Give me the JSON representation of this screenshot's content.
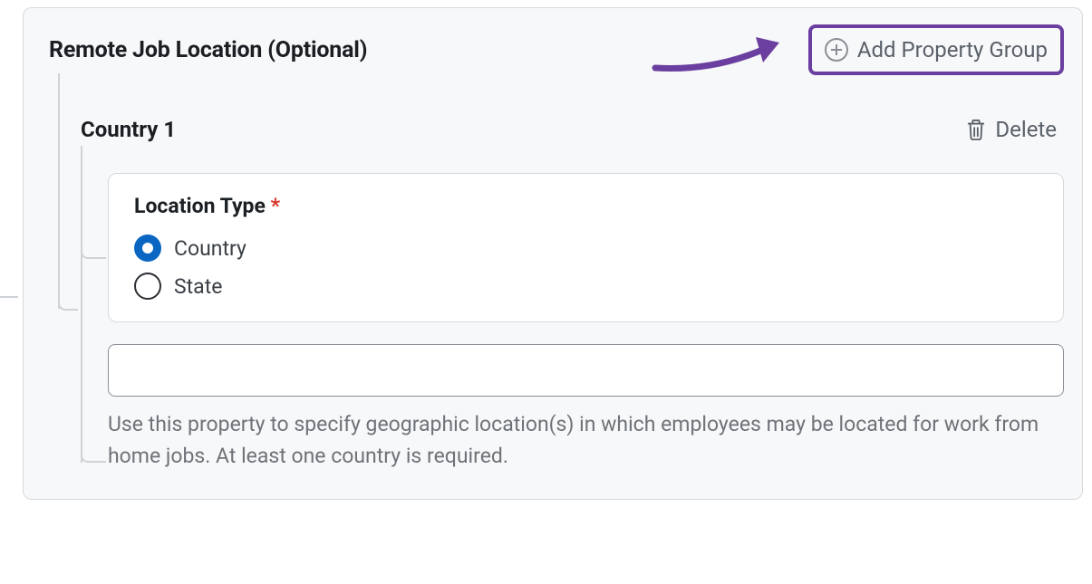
{
  "section": {
    "title": "Remote Job Location (Optional)",
    "add_group_label": "Add Property Group"
  },
  "group": {
    "title": "Country 1",
    "delete_label": "Delete",
    "location_type": {
      "label": "Location Type",
      "required_marker": "*",
      "options": [
        {
          "label": "Country",
          "selected": true
        },
        {
          "label": "State",
          "selected": false
        }
      ]
    },
    "value_input": {
      "value": "",
      "placeholder": ""
    },
    "helper_text": "Use this property to specify geographic location(s) in which employees may be located for work from home jobs. At least one country is required."
  },
  "colors": {
    "annotation": "#6b3fa0",
    "accent": "#0a66c2"
  }
}
